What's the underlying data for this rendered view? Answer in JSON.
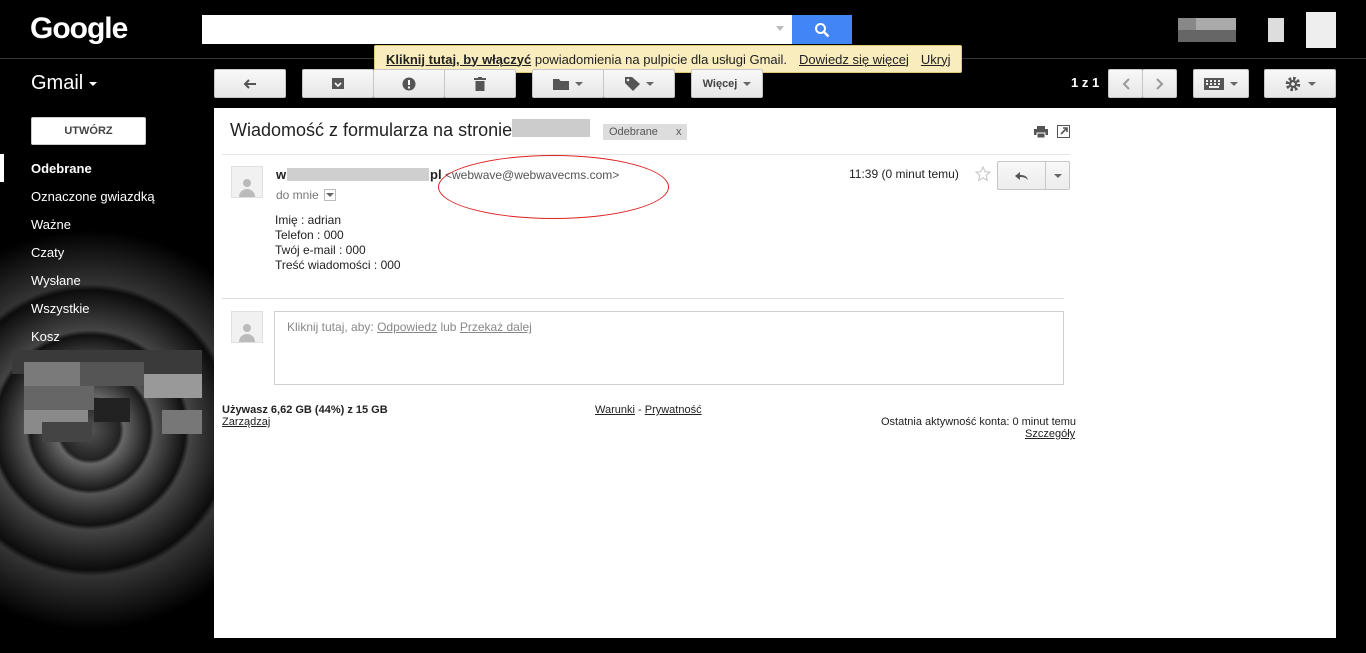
{
  "header": {
    "logo": "Google",
    "search_placeholder": ""
  },
  "notice": {
    "enable_link": "Kliknij tutaj, by włączyć",
    "text": "powiadomienia na pulpicie dla usługi Gmail.",
    "learn_more": "Dowiedz się więcej",
    "hide": "Ukryj"
  },
  "app": {
    "name": "Gmail"
  },
  "toolbar": {
    "more_label": "Więcej",
    "pager": "1 z 1"
  },
  "sidebar": {
    "compose": "UTWÓRZ",
    "items": [
      {
        "label": "Odebrane",
        "active": true
      },
      {
        "label": "Oznaczone gwiazdką"
      },
      {
        "label": "Ważne"
      },
      {
        "label": "Czaty"
      },
      {
        "label": "Wysłane"
      },
      {
        "label": "Wszystkie"
      },
      {
        "label": "Kosz"
      }
    ]
  },
  "message": {
    "subject": "Wiadomość z formularza na stronie",
    "label_chip": "Odebrane",
    "label_remove": "x",
    "sender_start": "w",
    "sender_end": "pl",
    "sender_email": "<webwave@webwavecms.com>",
    "to": "do mnie",
    "time": "11:39 (0 minut temu)",
    "body": [
      "Imię : adrian",
      "Telefon : 000",
      "Twój e-mail : 000",
      "Treść wiadomości : 000"
    ]
  },
  "reply": {
    "prompt": "Kliknij tutaj, aby:",
    "reply_link": "Odpowiedz",
    "or": "lub",
    "forward_link": "Przekaż dalej"
  },
  "footer": {
    "storage": "Używasz 6,62 GB (44%) z 15 GB",
    "manage": "Zarządzaj",
    "terms": "Warunki",
    "sep": "-",
    "privacy": "Prywatność",
    "last_activity": "Ostatnia aktywność konta: 0 minut temu",
    "details": "Szczegóły"
  },
  "colors": {
    "accent_blue": "#4285f4",
    "notice_bg": "#f9edbe",
    "annotation_red": "#dd2222"
  }
}
